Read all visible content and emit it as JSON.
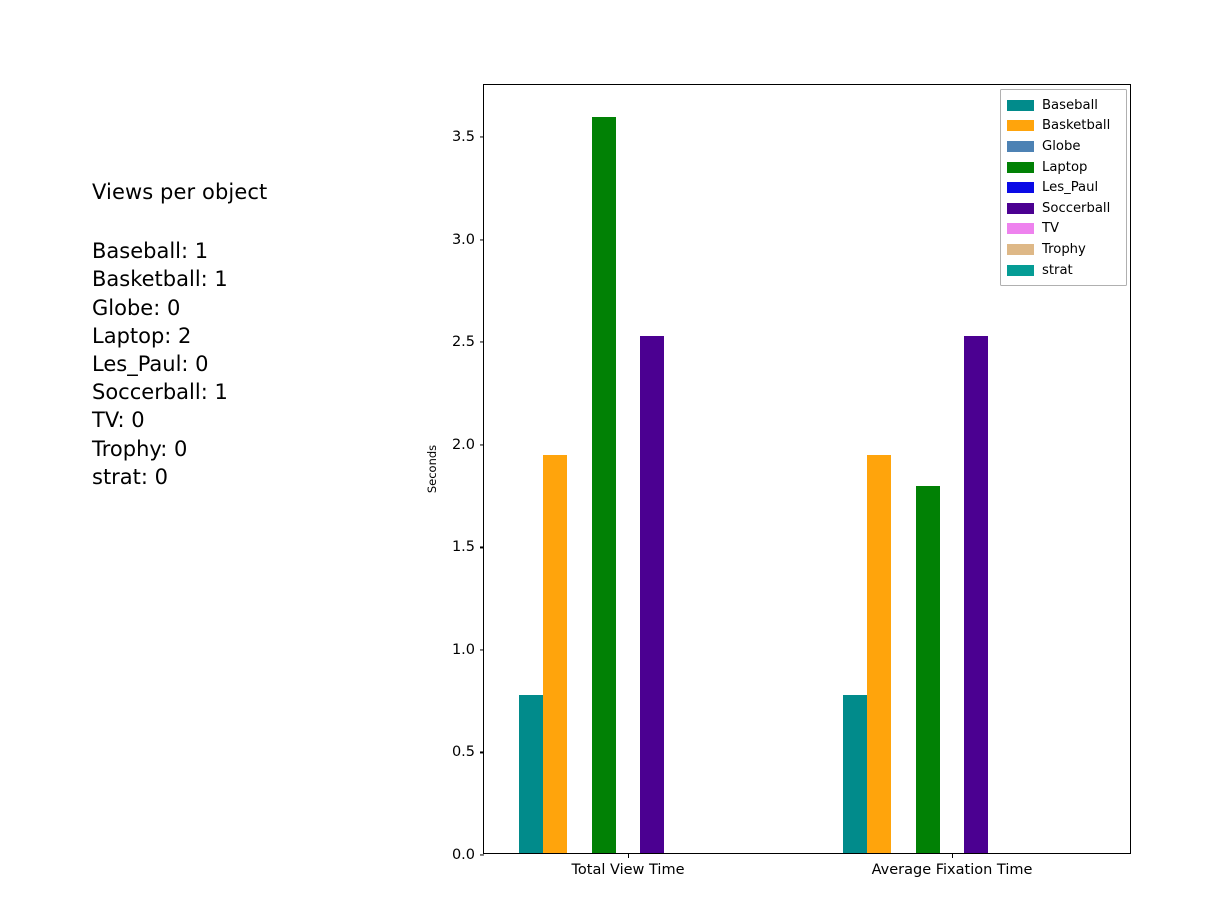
{
  "info": {
    "title": "Views per object",
    "lines": [
      "Baseball: 1",
      "Basketball: 1",
      "Globe: 0",
      "Laptop: 2",
      "Les_Paul: 0",
      "Soccerball: 1",
      "TV: 0",
      "Trophy: 0",
      "strat: 0"
    ]
  },
  "chart_data": {
    "type": "bar",
    "title": "",
    "xlabel": "",
    "ylabel": "Seconds",
    "categories": [
      "Total View Time",
      "Average Fixation Time"
    ],
    "yticks": [
      "0.0",
      "0.5",
      "1.0",
      "1.5",
      "2.0",
      "2.5",
      "3.0",
      "3.5"
    ],
    "ytick_values": [
      0.0,
      0.5,
      1.0,
      1.5,
      2.0,
      2.5,
      3.0,
      3.5
    ],
    "ylim": [
      0.0,
      3.755
    ],
    "grid": false,
    "legend_position": "upper right",
    "series": [
      {
        "name": "Baseball",
        "color": "#018b8b",
        "values": [
          0.77,
          0.77
        ]
      },
      {
        "name": "Basketball",
        "color": "#ffa40c",
        "values": [
          1.94,
          1.94
        ]
      },
      {
        "name": "Globe",
        "color": "#4d82b4",
        "values": [
          0.0,
          0.0
        ]
      },
      {
        "name": "Laptop",
        "color": "#018105",
        "values": [
          3.59,
          1.79
        ]
      },
      {
        "name": "Les_Paul",
        "color": "#0a0ae6",
        "values": [
          0.0,
          0.0
        ]
      },
      {
        "name": "Soccerball",
        "color": "#4b0091",
        "values": [
          2.52,
          2.52
        ]
      },
      {
        "name": "TV",
        "color": "#ee82ee",
        "values": [
          0.0,
          0.0
        ]
      },
      {
        "name": "Trophy",
        "color": "#deb887",
        "values": [
          0.0,
          0.0
        ]
      },
      {
        "name": "strat",
        "color": "#059c95",
        "values": [
          0.0,
          0.0
        ]
      }
    ]
  }
}
